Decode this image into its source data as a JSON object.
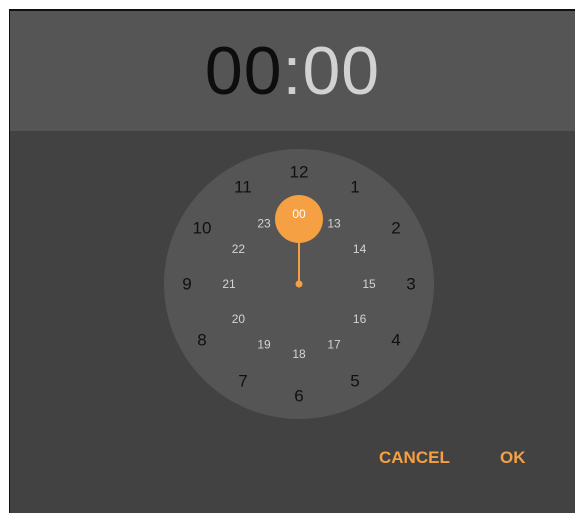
{
  "header": {
    "hours": "00",
    "separator": ":",
    "minutes": "00"
  },
  "clock": {
    "outer_labels": [
      "12",
      "1",
      "2",
      "3",
      "4",
      "5",
      "6",
      "7",
      "8",
      "9",
      "10",
      "11"
    ],
    "inner_labels": [
      "00",
      "13",
      "14",
      "15",
      "16",
      "17",
      "18",
      "19",
      "20",
      "21",
      "22",
      "23"
    ],
    "selected_label": "00",
    "accent_color": "#f5a042"
  },
  "actions": {
    "cancel_label": "CANCEL",
    "ok_label": "OK"
  }
}
